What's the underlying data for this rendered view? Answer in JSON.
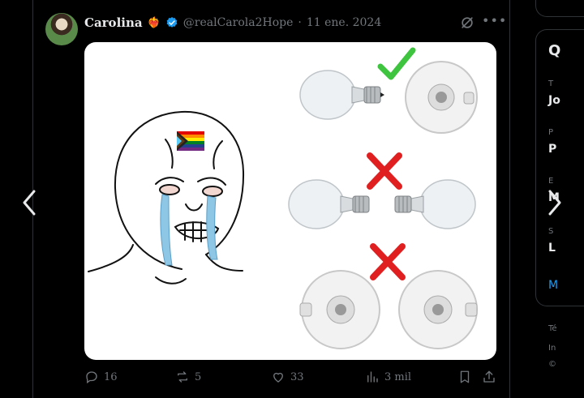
{
  "post": {
    "author_name": "Carolina",
    "author_emoji": "❤️‍🔥",
    "handle": "@realCarola2Hope",
    "separator": "·",
    "date": "11 ene. 2024"
  },
  "actions": {
    "replies": "16",
    "reposts": "5",
    "likes": "33",
    "views": "3 mil"
  },
  "sidebar_fragments": {
    "heading": "Q",
    "f1_label": "T",
    "f1_value": "Jo",
    "f2_label": "P",
    "f2_value": "P",
    "f3_label": "E",
    "f3_value": "M",
    "f4_label": "S",
    "f4_value": "L",
    "link": "M",
    "footer1": "Té",
    "footer2": "In",
    "footer3": "©"
  },
  "colors": {
    "background": "#000000",
    "text": "#e7e9ea",
    "muted": "#71767b",
    "verified": "#1d9bf0",
    "check": "#3ec43e",
    "cross": "#e02020"
  },
  "icons": [
    "verified-badge-icon",
    "grok-icon",
    "more-icon",
    "reply-icon",
    "repost-icon",
    "like-icon",
    "views-icon",
    "bookmark-icon",
    "share-icon",
    "chevron-left-icon",
    "chevron-right-icon"
  ]
}
